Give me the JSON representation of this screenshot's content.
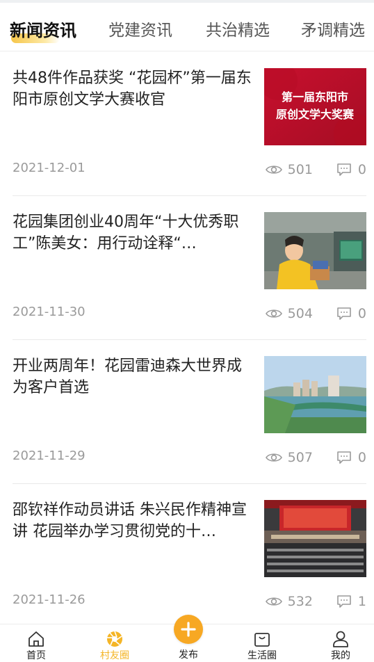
{
  "tabs": [
    {
      "label": "新闻资讯",
      "active": true
    },
    {
      "label": "党建资讯",
      "active": false
    },
    {
      "label": "共治精选",
      "active": false
    },
    {
      "label": "矛调精选",
      "active": false
    }
  ],
  "accent_color": "#f4b526",
  "articles": [
    {
      "title": "共48件作品获奖 “花园杯”第一届东阳市原创文学大赛收官",
      "date": "2021-12-01",
      "views": "501",
      "comments": "0",
      "thumb_text_line1": "第一届东阳市",
      "thumb_text_line2": "原创文学大奖赛"
    },
    {
      "title": "花园集团创业40周年“十大优秀职工”陈美女：用行动诠释“…",
      "date": "2021-11-30",
      "views": "504",
      "comments": "0"
    },
    {
      "title": "开业两周年！花园雷迪森大世界成为客户首选",
      "date": "2021-11-29",
      "views": "507",
      "comments": "0"
    },
    {
      "title": "邵钦祥作动员讲话 朱兴民作精神宣讲 花园举办学习贯彻党的十…",
      "date": "2021-11-26",
      "views": "532",
      "comments": "1"
    }
  ],
  "bottom_nav": [
    {
      "label": "首页",
      "icon": "home-icon",
      "active": false
    },
    {
      "label": "村友圈",
      "icon": "aperture-icon",
      "active": true
    },
    {
      "label": "发布",
      "icon": "plus-icon",
      "active": false
    },
    {
      "label": "生活圈",
      "icon": "shopping-bag-icon",
      "active": false
    },
    {
      "label": "我的",
      "icon": "user-icon",
      "active": false
    }
  ]
}
